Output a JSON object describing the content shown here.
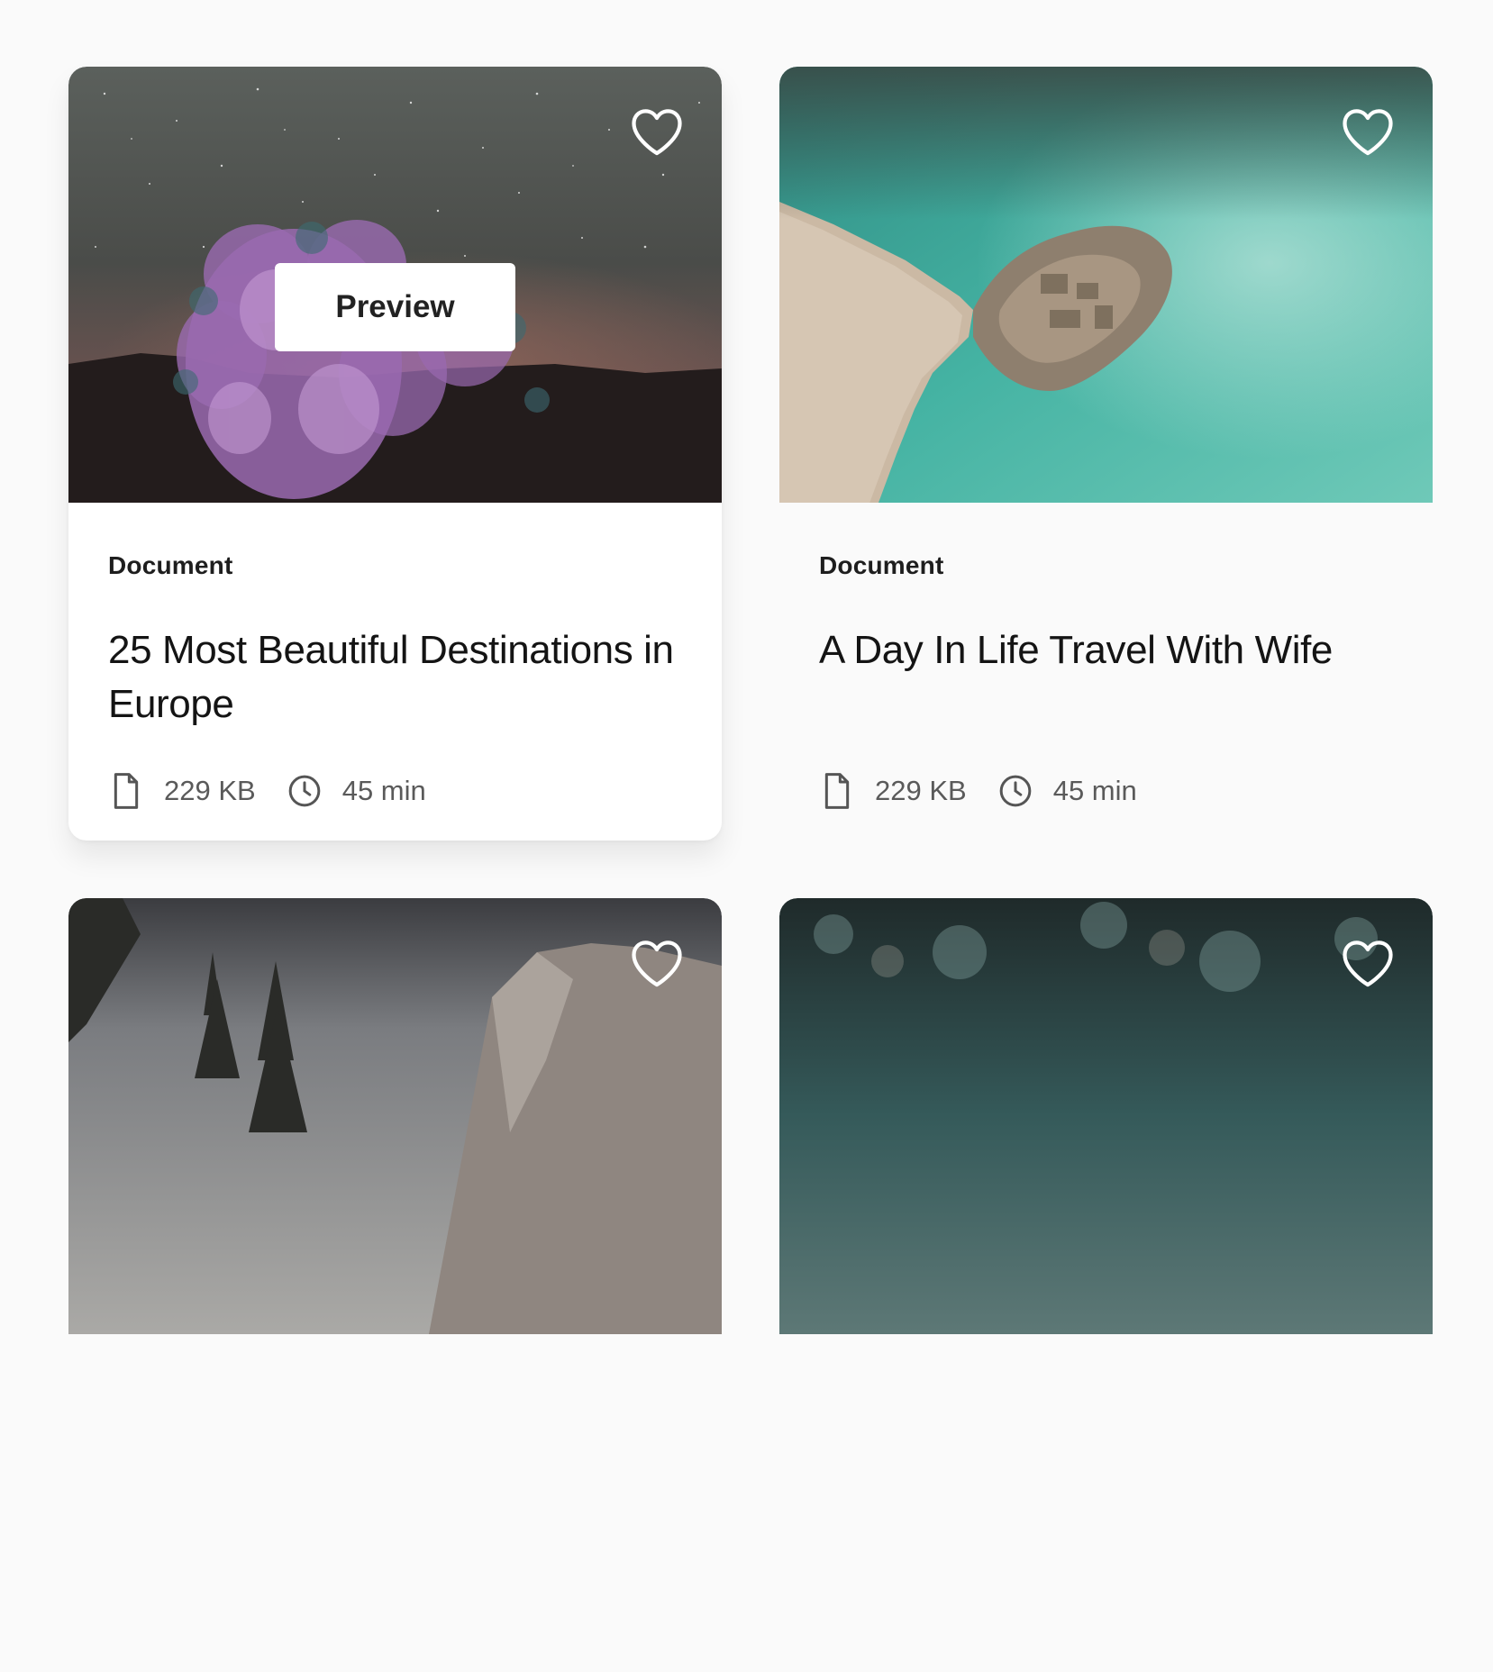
{
  "cards": [
    {
      "category": "Document",
      "title": "25 Most Beautiful Destinations in Europe",
      "file_size": "229 KB",
      "duration": "45 min",
      "preview_label": "Preview",
      "image": "joshua-tree-night-sky"
    },
    {
      "category": "Document",
      "title": "A Day In Life Travel With Wife",
      "file_size": "229 KB",
      "duration": "45 min",
      "image": "aerial-island-turquoise-water"
    },
    {
      "image": "mountain-dusk-trees"
    },
    {
      "image": "blurred-teal-bokeh"
    }
  ],
  "icons": {
    "favorite": "heart-icon",
    "file": "file-icon",
    "time": "clock-icon"
  },
  "colors": {
    "background": "#fafafa",
    "card": "#ffffff",
    "text_primary": "#141414",
    "text_secondary": "#5a5a5a",
    "water": "#4fb8a6"
  }
}
